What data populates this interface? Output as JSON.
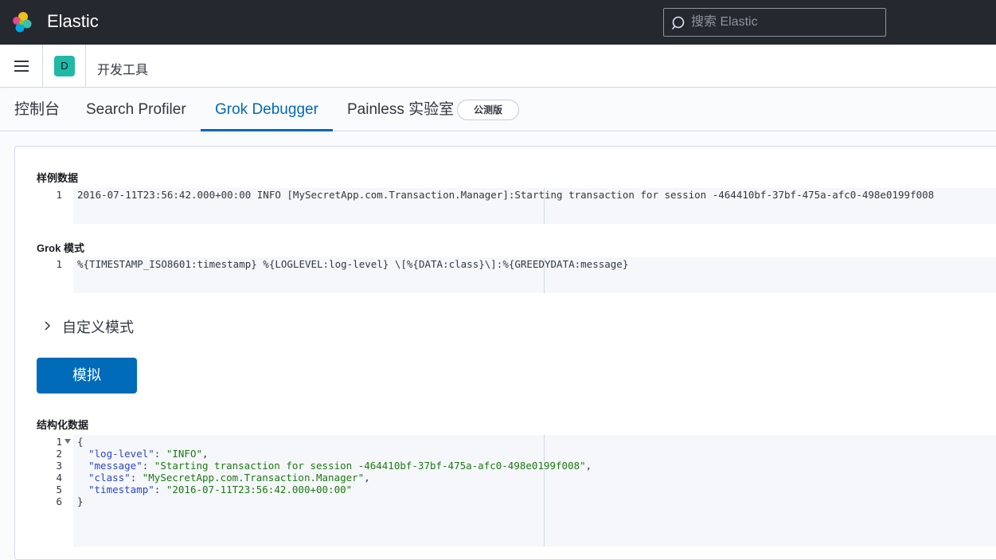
{
  "header": {
    "brand": "Elastic",
    "search_placeholder": "搜索 Elastic"
  },
  "navbar": {
    "space_initial": "D",
    "breadcrumb": "开发工具"
  },
  "tabs": [
    {
      "label": "控制台"
    },
    {
      "label": "Search Profiler"
    },
    {
      "label": "Grok Debugger"
    },
    {
      "label": "Painless 实验室"
    }
  ],
  "beta_badge": "公测版",
  "sample_data": {
    "label": "样例数据",
    "line_numbers": [
      "1"
    ],
    "lines": [
      "2016-07-11T23:56:42.000+00:00 INFO [MySecretApp.com.Transaction.Manager]:Starting transaction for session -464410bf-37bf-475a-afc0-498e0199f008"
    ]
  },
  "grok_pattern": {
    "label": "Grok 模式",
    "line_numbers": [
      "1"
    ],
    "lines": [
      "%{TIMESTAMP_ISO8601:timestamp} %{LOGLEVEL:log-level} \\[%{DATA:class}\\]:%{GREEDYDATA:message}"
    ]
  },
  "custom_patterns_label": "自定义模式",
  "simulate_button": "模拟",
  "structured_data": {
    "label": "结构化数据",
    "line_numbers": [
      "1",
      "2",
      "3",
      "4",
      "5",
      "6"
    ],
    "open_brace": "{",
    "close_brace": "}",
    "fields": [
      {
        "key": "\"log-level\"",
        "value": "\"INFO\"",
        "sep": ","
      },
      {
        "key": "\"message\"",
        "value": "\"Starting transaction for session -464410bf-37bf-475a-afc0-498e0199f008\"",
        "sep": ","
      },
      {
        "key": "\"class\"",
        "value": "\"MySecretApp.com.Transaction.Manager\"",
        "sep": ","
      },
      {
        "key": "\"timestamp\"",
        "value": "\"2016-07-11T23:56:42.000+00:00\"",
        "sep": ""
      }
    ]
  },
  "colors": {
    "accent": "#006bb8",
    "header_bg": "#25282f",
    "space_avatar": "#20b9a5"
  }
}
